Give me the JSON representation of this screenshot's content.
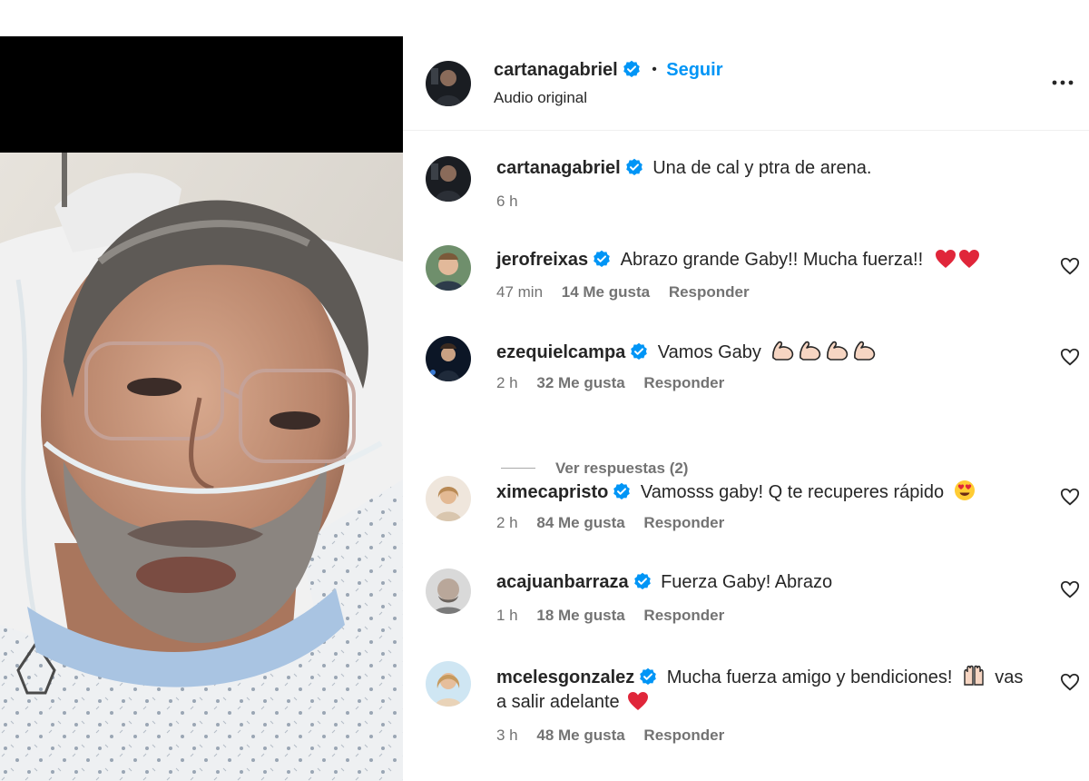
{
  "post": {
    "author": "cartanagabriel",
    "separator": "•",
    "follow_label": "Seguir",
    "audio_label": "Audio original",
    "more_label": "•••"
  },
  "caption": {
    "username": "cartanagabriel",
    "text": "Una de cal y ptra de arena.",
    "time": "6 h"
  },
  "comments": [
    {
      "username": "jerofreixas",
      "text": "Abrazo grande Gaby!! Mucha fuerza!!",
      "emoji_names": [
        "red-heart",
        "red-heart"
      ],
      "time": "47 min",
      "likes": "14 Me gusta",
      "reply": "Responder"
    },
    {
      "username": "ezequielcampa",
      "text": "Vamos Gaby",
      "emoji_names": [
        "flexed-biceps",
        "flexed-biceps",
        "flexed-biceps",
        "flexed-biceps"
      ],
      "time": "2 h",
      "likes": "32 Me gusta",
      "reply": "Responder",
      "view_replies": "Ver respuestas (2)"
    },
    {
      "username": "ximecapristo",
      "text": "Vamosss gaby! Q te recuperes rápido",
      "emoji_names": [
        "heart-eyes"
      ],
      "time": "2 h",
      "likes": "84 Me gusta",
      "reply": "Responder"
    },
    {
      "username": "acajuanbarraza",
      "text": "Fuerza Gaby! Abrazo",
      "time": "1 h",
      "likes": "18 Me gusta",
      "reply": "Responder"
    },
    {
      "username": "mcelesgonzalez",
      "text": "Mucha fuerza amigo y bendiciones!",
      "text_cont": "vas",
      "text_line2": "a salir adelante",
      "emoji_names": [
        "raising-hands",
        "red-heart"
      ],
      "time": "3 h",
      "likes": "48 Me gusta",
      "reply": "Responder"
    }
  ],
  "colors": {
    "accent": "#0095f6",
    "verified": "#0095f6",
    "text": "#262626",
    "muted": "#737373",
    "heart_red": "#e0263a"
  }
}
